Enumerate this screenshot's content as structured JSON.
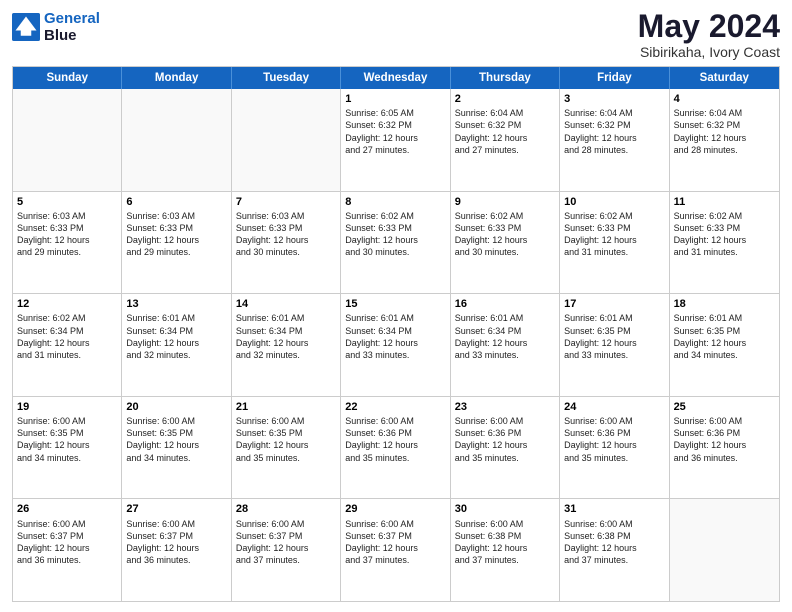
{
  "header": {
    "logo_line1": "General",
    "logo_line2": "Blue",
    "month": "May 2024",
    "location": "Sibirikaha, Ivory Coast"
  },
  "weekdays": [
    "Sunday",
    "Monday",
    "Tuesday",
    "Wednesday",
    "Thursday",
    "Friday",
    "Saturday"
  ],
  "rows": [
    [
      {
        "day": "",
        "info": "",
        "empty": true
      },
      {
        "day": "",
        "info": "",
        "empty": true
      },
      {
        "day": "",
        "info": "",
        "empty": true
      },
      {
        "day": "1",
        "info": "Sunrise: 6:05 AM\nSunset: 6:32 PM\nDaylight: 12 hours\nand 27 minutes."
      },
      {
        "day": "2",
        "info": "Sunrise: 6:04 AM\nSunset: 6:32 PM\nDaylight: 12 hours\nand 27 minutes."
      },
      {
        "day": "3",
        "info": "Sunrise: 6:04 AM\nSunset: 6:32 PM\nDaylight: 12 hours\nand 28 minutes."
      },
      {
        "day": "4",
        "info": "Sunrise: 6:04 AM\nSunset: 6:32 PM\nDaylight: 12 hours\nand 28 minutes."
      }
    ],
    [
      {
        "day": "5",
        "info": "Sunrise: 6:03 AM\nSunset: 6:33 PM\nDaylight: 12 hours\nand 29 minutes."
      },
      {
        "day": "6",
        "info": "Sunrise: 6:03 AM\nSunset: 6:33 PM\nDaylight: 12 hours\nand 29 minutes."
      },
      {
        "day": "7",
        "info": "Sunrise: 6:03 AM\nSunset: 6:33 PM\nDaylight: 12 hours\nand 30 minutes."
      },
      {
        "day": "8",
        "info": "Sunrise: 6:02 AM\nSunset: 6:33 PM\nDaylight: 12 hours\nand 30 minutes."
      },
      {
        "day": "9",
        "info": "Sunrise: 6:02 AM\nSunset: 6:33 PM\nDaylight: 12 hours\nand 30 minutes."
      },
      {
        "day": "10",
        "info": "Sunrise: 6:02 AM\nSunset: 6:33 PM\nDaylight: 12 hours\nand 31 minutes."
      },
      {
        "day": "11",
        "info": "Sunrise: 6:02 AM\nSunset: 6:33 PM\nDaylight: 12 hours\nand 31 minutes."
      }
    ],
    [
      {
        "day": "12",
        "info": "Sunrise: 6:02 AM\nSunset: 6:34 PM\nDaylight: 12 hours\nand 31 minutes."
      },
      {
        "day": "13",
        "info": "Sunrise: 6:01 AM\nSunset: 6:34 PM\nDaylight: 12 hours\nand 32 minutes."
      },
      {
        "day": "14",
        "info": "Sunrise: 6:01 AM\nSunset: 6:34 PM\nDaylight: 12 hours\nand 32 minutes."
      },
      {
        "day": "15",
        "info": "Sunrise: 6:01 AM\nSunset: 6:34 PM\nDaylight: 12 hours\nand 33 minutes."
      },
      {
        "day": "16",
        "info": "Sunrise: 6:01 AM\nSunset: 6:34 PM\nDaylight: 12 hours\nand 33 minutes."
      },
      {
        "day": "17",
        "info": "Sunrise: 6:01 AM\nSunset: 6:35 PM\nDaylight: 12 hours\nand 33 minutes."
      },
      {
        "day": "18",
        "info": "Sunrise: 6:01 AM\nSunset: 6:35 PM\nDaylight: 12 hours\nand 34 minutes."
      }
    ],
    [
      {
        "day": "19",
        "info": "Sunrise: 6:00 AM\nSunset: 6:35 PM\nDaylight: 12 hours\nand 34 minutes."
      },
      {
        "day": "20",
        "info": "Sunrise: 6:00 AM\nSunset: 6:35 PM\nDaylight: 12 hours\nand 34 minutes."
      },
      {
        "day": "21",
        "info": "Sunrise: 6:00 AM\nSunset: 6:35 PM\nDaylight: 12 hours\nand 35 minutes."
      },
      {
        "day": "22",
        "info": "Sunrise: 6:00 AM\nSunset: 6:36 PM\nDaylight: 12 hours\nand 35 minutes."
      },
      {
        "day": "23",
        "info": "Sunrise: 6:00 AM\nSunset: 6:36 PM\nDaylight: 12 hours\nand 35 minutes."
      },
      {
        "day": "24",
        "info": "Sunrise: 6:00 AM\nSunset: 6:36 PM\nDaylight: 12 hours\nand 35 minutes."
      },
      {
        "day": "25",
        "info": "Sunrise: 6:00 AM\nSunset: 6:36 PM\nDaylight: 12 hours\nand 36 minutes."
      }
    ],
    [
      {
        "day": "26",
        "info": "Sunrise: 6:00 AM\nSunset: 6:37 PM\nDaylight: 12 hours\nand 36 minutes."
      },
      {
        "day": "27",
        "info": "Sunrise: 6:00 AM\nSunset: 6:37 PM\nDaylight: 12 hours\nand 36 minutes."
      },
      {
        "day": "28",
        "info": "Sunrise: 6:00 AM\nSunset: 6:37 PM\nDaylight: 12 hours\nand 37 minutes."
      },
      {
        "day": "29",
        "info": "Sunrise: 6:00 AM\nSunset: 6:37 PM\nDaylight: 12 hours\nand 37 minutes."
      },
      {
        "day": "30",
        "info": "Sunrise: 6:00 AM\nSunset: 6:38 PM\nDaylight: 12 hours\nand 37 minutes."
      },
      {
        "day": "31",
        "info": "Sunrise: 6:00 AM\nSunset: 6:38 PM\nDaylight: 12 hours\nand 37 minutes."
      },
      {
        "day": "",
        "info": "",
        "empty": true
      }
    ]
  ]
}
